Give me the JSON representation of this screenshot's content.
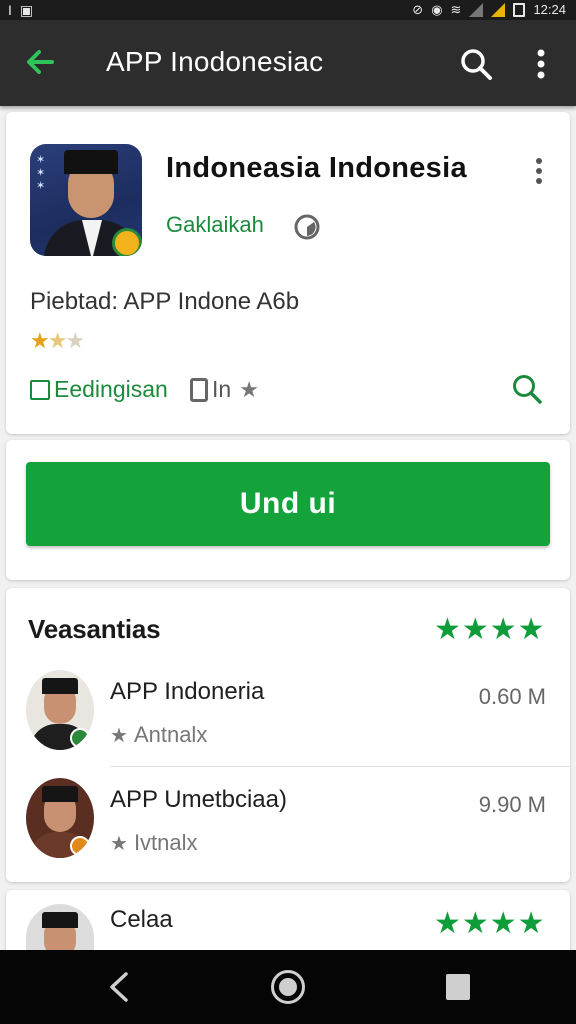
{
  "status_bar": {
    "left_glyph_1": "I",
    "left_glyph_2": "▣",
    "right_glyph_1": "⊘",
    "right_glyph_2": "◉",
    "right_glyph_3": "≋",
    "time": "12:24"
  },
  "app_bar": {
    "title": "APP Inodonesiac"
  },
  "app_card": {
    "name": "Indoneasia Indonesia",
    "developer": "Gaklaikah",
    "description": "Piebtad: APP Indone A6b",
    "rating_stars": "★★★",
    "tag_primary": "Eedingisan",
    "tag_secondary": "In",
    "tag_secondary_star": "★"
  },
  "install": {
    "button_label": "Und ui"
  },
  "list": {
    "title": "Veasantias",
    "title_stars": "★★★★",
    "items": [
      {
        "name": "APP Indoneria",
        "sub_star": "★",
        "sub": "Antnalx",
        "size": "0.60 M"
      },
      {
        "name": "APP Umetbciaa)",
        "sub_star": "★",
        "sub": "Ivtnalx",
        "size": "9.90 M"
      }
    ]
  },
  "bottom": {
    "title": "Celaa",
    "stars": "★★★★"
  },
  "colors": {
    "accent_green": "#13a33a",
    "text_green": "#1c8a3c",
    "app_bar": "#2d2d2d",
    "nav_bar": "#050505"
  },
  "icons": [
    "arrow-back-icon",
    "search-icon",
    "more-vert-icon",
    "verified-icon",
    "flag-icon",
    "star-icon",
    "nav-back-icon",
    "nav-home-icon",
    "nav-recents-icon"
  ]
}
